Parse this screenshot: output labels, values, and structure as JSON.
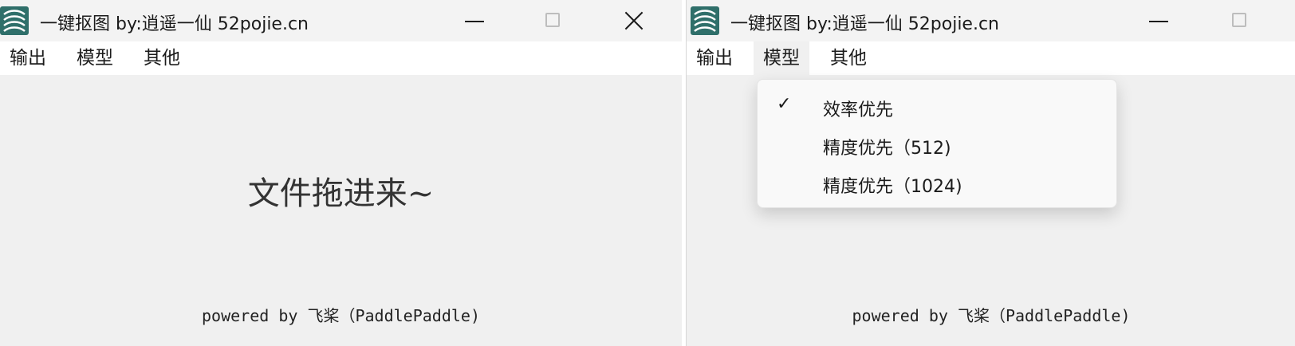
{
  "windows": [
    {
      "title": "一键抠图  by:逍遥一仙 52pojie.cn",
      "menu": [
        "输出",
        "模型",
        "其他"
      ],
      "drop_text": "文件拖进来~",
      "powered": "powered by 飞桨（PaddlePaddle)"
    },
    {
      "title": "一键抠图  by:逍遥一仙 52pojie.cn",
      "menu": [
        "输出",
        "模型",
        "其他"
      ],
      "powered": "powered by 飞桨（PaddlePaddle)",
      "model_menu": {
        "check_mark": "✓",
        "items": [
          "效率优先",
          "精度优先（512)",
          "精度优先（1024)"
        ],
        "checked_index": 0
      }
    }
  ],
  "colors": {
    "client_bg": "#f0f0f0",
    "menubar_bg": "#ffffff",
    "titlebar_bg": "#f3f3f3",
    "icon_teal": "#2f6f6a"
  },
  "icons": [
    "app-icon",
    "minimize-icon",
    "maximize-icon",
    "close-icon",
    "check-icon"
  ]
}
